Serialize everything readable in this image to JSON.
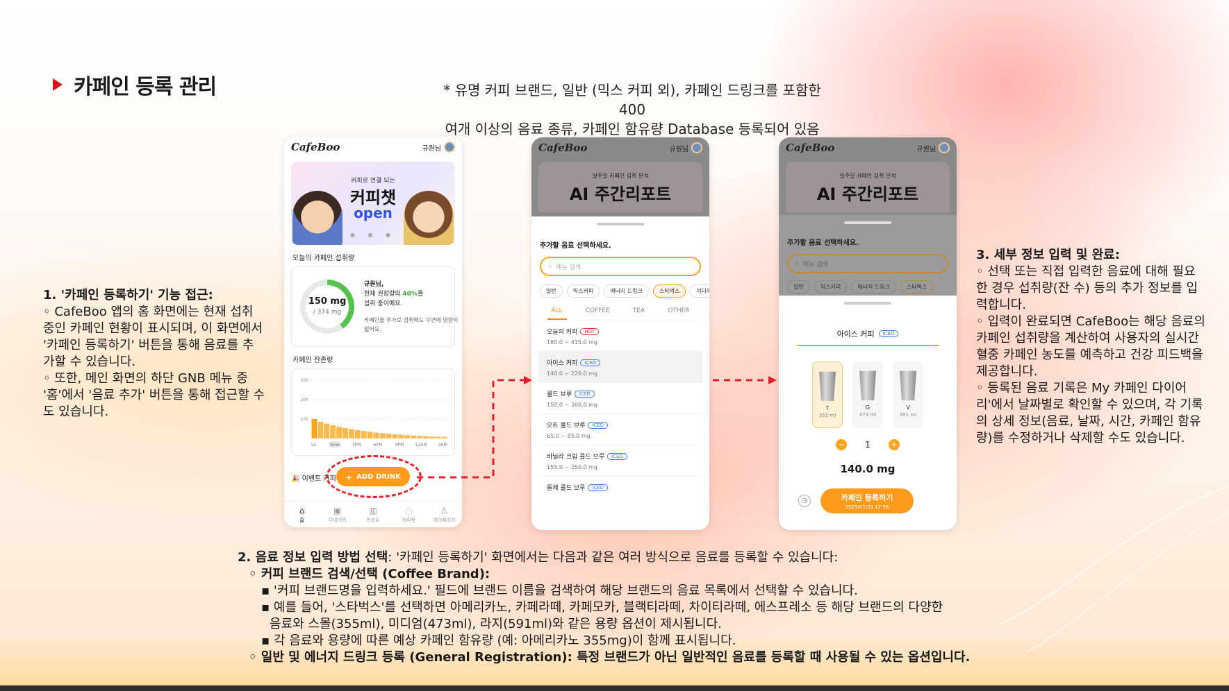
{
  "title": "카페인 등록 관리",
  "top_note": {
    "line1": "* 유명 커피 브랜드, 일반 (믹스 커피 외), 카페인 드링크를 포함한 400",
    "line2": "여개 이상의 음료 종류, 카페인 함유량 Database 등록되어 있음"
  },
  "desc1": {
    "heading": "1. '카페인 등록하기' 기능 접근:",
    "p1": "◦ CafeBoo 앱의 홈 화면에는 현재 섭취 중인 카페인 현황이 표시되며, 이 화면에서 '카페인 등록하기' 버튼을 통해 음료를 추가할 수 있습니다.",
    "p2": "◦ 또한, 메인 화면의 하단 GNB 메뉴 중 '홈'에서 '음료 추가' 버튼을 통해 접근할 수도 있습니다."
  },
  "desc2": {
    "heading_bold": "2. 음료 정보 입력 방법 선택",
    "heading_rest": ": '카페인 등록하기' 화면에서는 다음과 같은 여러 방식으로 음료를 등록할 수 있습니다:",
    "brand_title": "◦ 커피 브랜드 검색/선택 (Coffee Brand):",
    "b1": "▪ '커피 브랜드명을 입력하세요.' 필드에 브랜드 이름을 검색하여 해당 브랜드의 음료 목록에서 선택할 수 있습니다.",
    "b2": "▪ 예를 들어, '스타벅스'를 선택하면 아메리카노, 카페라떼, 카페모카, 블랙티라떼, 차이티라떼, 에스프레소 등 해당 브랜드의 다양한",
    "b2b": "음료와 스몰(355ml), 미디엄(473ml), 라지(591ml)와 같은 용량 옵션이 제시됩니다.",
    "b3": "▪ 각 음료와 용량에 따른 예상 카페인 함유량 (예: 아메리카노 355mg)이 함께 표시됩니다.",
    "general": "◦ 일반 및 에너지 드링크 등록 (General Registration): 특정 브랜드가 아닌 일반적인 음료를 등록할 때 사용될 수 있는 옵션입니다."
  },
  "desc3": {
    "heading": "3. 세부 정보 입력 및 완료:",
    "p1": "◦ 선택 또는 직접 입력한 음료에 대해 필요한 경우 섭취량(잔 수) 등의 추가 정보를 입력합니다.",
    "p2": "◦ 입력이 완료되면 CafeBoo는 해당 음료의 카페인 섭취량을 계산하여 사용자의 실시간 혈중 카페인 농도를 예측하고 건강 피드백을 제공합니다.",
    "p3": "◦ 등록된 음료 기록은 My 카페인 다이어리'에서 날짜별로 확인할 수 있으며, 각 기록의 상세 정보(음료, 날짜, 시간, 카페인 함유량)를 수정하거나 삭제할 수도 있습니다."
  },
  "phone1": {
    "logo": "CafeBoo",
    "user": "규원님",
    "banner_sub": "커피로 연결 되는",
    "banner_title": "커피챗",
    "banner_open": "open",
    "intake_label": "오늘의 카페인 섭취량",
    "intake_value": "150 mg",
    "intake_max": "/ 374 mg",
    "intake_percent": 40,
    "intake_line1": "규원님,",
    "intake_line2a": "현재 권장량의 ",
    "intake_pct_text": "40%",
    "intake_line2b": "를",
    "intake_line3": "섭취 중이에요.",
    "intake_note": "카페인을 추가로 섭취해도 수면에 영향이 없어요.",
    "chart_label": "카페인 잔존량",
    "event_label": "🎉 이벤트 커피",
    "add_drink": "ADD DRINK",
    "gnb": [
      "홈",
      "다이어리",
      "리포트",
      "커피챗",
      "마이페이지"
    ]
  },
  "chart_data": {
    "type": "bar",
    "title": "카페인 잔존량",
    "ylim": [
      0,
      300
    ],
    "yticks": [
      100,
      200,
      300
    ],
    "xticks": [
      "12",
      "Now",
      "3PM",
      "6PM",
      "9PM",
      "12AM",
      "3AM"
    ],
    "values": [
      100,
      86,
      76,
      68,
      60,
      54,
      48,
      43,
      38,
      34,
      30,
      27,
      24,
      21,
      19,
      17,
      15,
      13,
      12,
      10,
      9,
      8
    ]
  },
  "phone2": {
    "logo": "CafeBoo",
    "user": "규원님",
    "banner_sub": "일주일 카페인 섭취 분석",
    "banner_title": "AI 주간리포트",
    "sheet_title": "추가할 음료 선택하세요.",
    "search_placeholder": "메뉴 검색",
    "chips": [
      "일반",
      "믹스커피",
      "에너지 드링크",
      "스타벅스",
      "이디야"
    ],
    "tabs": [
      "ALL",
      "COFFEE",
      "TEA",
      "OTHER"
    ],
    "drinks": [
      {
        "name": "오늘의 커피",
        "tag": "HOT",
        "range": "180.0 ~ 415.0 mg"
      },
      {
        "name": "아이스 커피",
        "tag": "ICED",
        "range": "140.0 ~ 220.0 mg"
      },
      {
        "name": "콜드 브루",
        "tag": "ICED",
        "range": "150.0 ~ 360.0 mg"
      },
      {
        "name": "오트 콜드 브루",
        "tag": "ICED",
        "range": "65.0 ~ 85.0 mg"
      },
      {
        "name": "바닐라 크림 콜드 브루",
        "tag": "ICED",
        "range": "155.0 ~ 250.0 mg"
      },
      {
        "name": "돌체 콜드 브루",
        "tag": "ICED",
        "range": ""
      }
    ]
  },
  "phone3": {
    "logo": "CafeBoo",
    "user": "규원님",
    "banner_sub": "일주일 카페인 섭취 분석",
    "banner_title": "AI 주간리포트",
    "sheet_title": "추가할 음료 선택하세요.",
    "search_placeholder": "메뉴 검색",
    "chips": [
      "일반",
      "믹스커피",
      "에너지 드링크",
      "스타벅스"
    ],
    "drink_name": "아이스 커피",
    "drink_tag": "ICED",
    "sizes": [
      {
        "label": "T",
        "ml": "355 ml"
      },
      {
        "label": "G",
        "ml": "473 ml"
      },
      {
        "label": "V",
        "ml": "591 ml"
      }
    ],
    "quantity": "1",
    "caffeine": "140.0 mg",
    "register_label": "카페인 등록하기",
    "register_date": "2025/07/29 12:56"
  }
}
